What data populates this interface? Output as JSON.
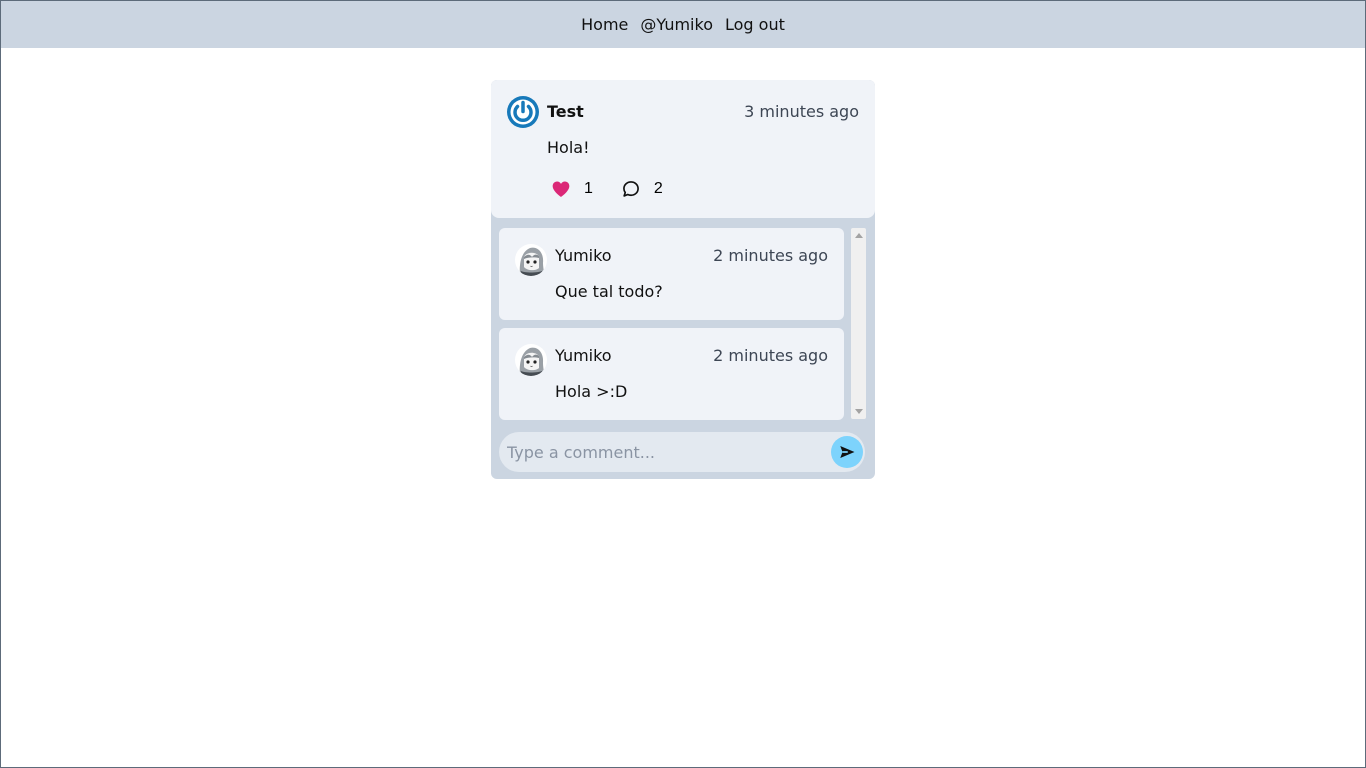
{
  "nav": {
    "home_label": "Home",
    "profile_label": "@Yumiko",
    "logout_label": "Log out"
  },
  "post": {
    "author": "Test",
    "time": "3 minutes ago",
    "text": "Hola!",
    "likes": "1",
    "comments": "2",
    "avatar_icon": "power-icon",
    "like_icon": "heart-icon",
    "comment_icon": "comment-bubble-icon",
    "avatar_color": "#1779ba",
    "like_color": "#db2777"
  },
  "comments": [
    {
      "author": "Yumiko",
      "time": "2 minutes ago",
      "text": "Que tal todo?",
      "avatar_icon": "anime-avatar-icon"
    },
    {
      "author": "Yumiko",
      "time": "2 minutes ago",
      "text": "Hola >:D",
      "avatar_icon": "anime-avatar-icon"
    }
  ],
  "comment_form": {
    "placeholder": "Type a comment...",
    "send_icon": "send-icon",
    "send_color": "#7dd3fc"
  }
}
